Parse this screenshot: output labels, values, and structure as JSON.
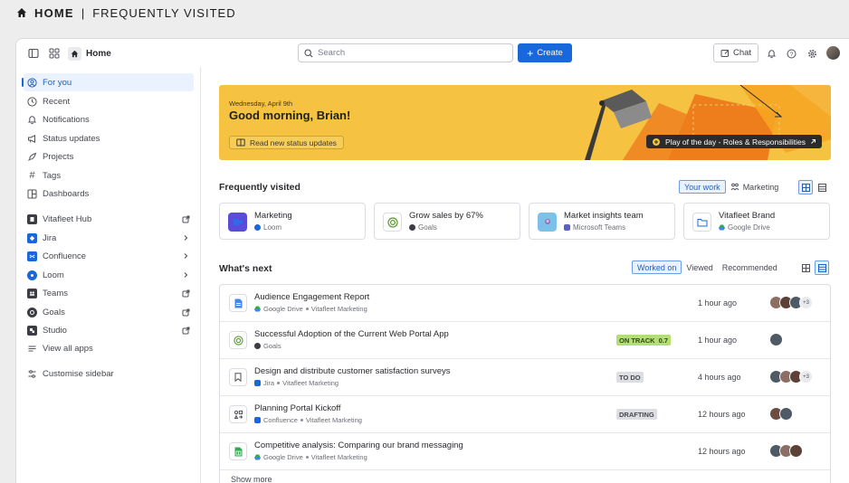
{
  "caption": {
    "bold": "HOME",
    "separator": "|",
    "rest": "FREQUENTLY VISITED"
  },
  "topbar": {
    "breadcrumb": "Home",
    "search_placeholder": "Search",
    "create_label": "Create",
    "chat_label": "Chat"
  },
  "sidebar": {
    "items": [
      {
        "label": "For you",
        "icon": "user-circle-icon"
      },
      {
        "label": "Recent",
        "icon": "clock-icon"
      },
      {
        "label": "Notifications",
        "icon": "bell-icon"
      },
      {
        "label": "Status updates",
        "icon": "megaphone-icon"
      },
      {
        "label": "Projects",
        "icon": "rocket-icon"
      },
      {
        "label": "Tags",
        "icon": "hash-icon"
      },
      {
        "label": "Dashboards",
        "icon": "dashboard-icon"
      }
    ],
    "apps": [
      {
        "label": "Vitafleet Hub",
        "icon": "hub-icon",
        "trail": "external-link-icon"
      },
      {
        "label": "Jira",
        "icon": "jira-icon",
        "trail": "chevron-right-icon"
      },
      {
        "label": "Confluence",
        "icon": "confluence-icon",
        "trail": "chevron-right-icon"
      },
      {
        "label": "Loom",
        "icon": "loom-icon",
        "trail": "chevron-right-icon"
      },
      {
        "label": "Teams",
        "icon": "teams-icon",
        "trail": "external-link-icon"
      },
      {
        "label": "Goals",
        "icon": "goals-icon",
        "trail": "external-link-icon"
      },
      {
        "label": "Studio",
        "icon": "studio-icon",
        "trail": "external-link-icon"
      },
      {
        "label": "View all apps",
        "icon": "list-icon"
      }
    ],
    "customise": "Customise sidebar"
  },
  "banner": {
    "date": "Wednesday, April 9th",
    "greeting": "Good morning, Brian!",
    "status_button": "Read new status updates",
    "play_label": "Play of the day - Roles & Responsibilities"
  },
  "frequently": {
    "title": "Frequently visited",
    "filters": [
      "Your work",
      "Marketing"
    ],
    "cards": [
      {
        "title": "Marketing",
        "app": "Loom",
        "icon": "loom-video-icon"
      },
      {
        "title": "Grow sales by 67%",
        "app": "Goals",
        "icon": "goal-target-icon"
      },
      {
        "title": "Market insights team",
        "app": "Microsoft Teams",
        "icon": "team-avatar-icon"
      },
      {
        "title": "Vitafleet Brand",
        "app": "Google Drive",
        "icon": "folder-icon"
      }
    ]
  },
  "whats_next": {
    "title": "What's next",
    "tabs": [
      "Worked on",
      "Viewed",
      "Recommended"
    ],
    "rows": [
      {
        "title": "Audience Engagement Report",
        "app": "Google Drive",
        "space": "Vitafleet Marketing",
        "status": "",
        "when": "1 hour ago",
        "more": "+3"
      },
      {
        "title": "Successful Adoption of the Current Web Portal App",
        "app": "Goals",
        "space": "",
        "status": "ON TRACK",
        "status_value": "0.7",
        "when": "1 hour ago",
        "more": ""
      },
      {
        "title": "Design and distribute customer satisfaction surveys",
        "app": "Jira",
        "space": "Vitafleet Marketing",
        "status": "TO DO",
        "when": "4 hours ago",
        "more": "+3"
      },
      {
        "title": "Planning Portal Kickoff",
        "app": "Confluence",
        "space": "Vitafleet Marketing",
        "status": "DRAFTING",
        "when": "12 hours ago",
        "more": ""
      },
      {
        "title": "Competitive analysis: Comparing our brand messaging",
        "app": "Google Drive",
        "space": "Vitafleet Marketing",
        "status": "",
        "when": "12 hours ago",
        "more": ""
      }
    ],
    "show_more": "Show more"
  },
  "colors": {
    "accent": "#1868db",
    "banner": "#f5c242",
    "on_track": "#b3df72",
    "neutral_lozenge": "#dddee1"
  }
}
